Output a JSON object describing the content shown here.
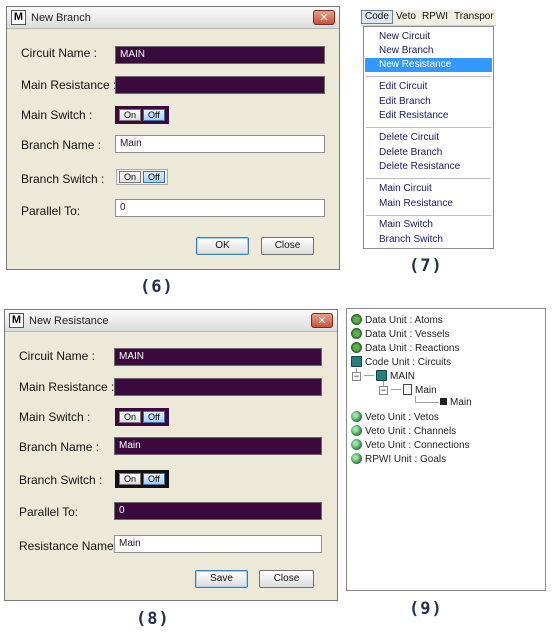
{
  "panel6": {
    "title": "New Branch",
    "app_icon": "M",
    "labels": {
      "circuit_name": "Circuit Name :",
      "main_resistance": "Main Resistance :",
      "main_switch": "Main Switch :",
      "branch_name": "Branch Name :",
      "branch_switch": "Branch Switch :",
      "parallel_to": "Parallel To:"
    },
    "values": {
      "circuit_name": "MAIN",
      "main_resistance": "",
      "branch_name": "Main",
      "parallel_to": "0"
    },
    "switch_on": "On",
    "switch_off": "Off",
    "ok_button": "OK",
    "close_button": "Close",
    "caption": "(6)"
  },
  "panel7": {
    "menubar": [
      "Code",
      "Veto",
      "RPWI",
      "Transpor"
    ],
    "items": [
      "New Circuit",
      "New Branch",
      "New Resistance",
      "Edit Circuit",
      "Edit Branch",
      "Edit Resistance",
      "Delete Circuit",
      "Delete Branch",
      "Delete Resistance",
      "Main Circuit",
      "Main Resistance",
      "Main Switch",
      "Branch Switch"
    ],
    "highlighted": "New Resistance",
    "caption": "(7)"
  },
  "panel8": {
    "title": "New Resistance",
    "app_icon": "M",
    "labels": {
      "circuit_name": "Circuit Name :",
      "main_resistance": "Main Resistance :",
      "main_switch": "Main Switch :",
      "branch_name": "Branch Name :",
      "branch_switch": "Branch Switch :",
      "parallel_to": "Parallel To:",
      "resistance_name": "Resistance Name"
    },
    "values": {
      "circuit_name": "MAIN",
      "main_resistance": "",
      "branch_name": "Main",
      "parallel_to": "0",
      "resistance_name": "Main"
    },
    "switch_on": "On",
    "switch_off": "Off",
    "save_button": "Save",
    "close_button": "Close",
    "caption": "(8)"
  },
  "panel9": {
    "nodes": [
      "Data Unit : Atoms",
      "Data Unit : Vessels",
      "Data Unit : Reactions",
      "Code Unit : Circuits",
      "MAIN",
      "Main",
      "Main",
      "Veto Unit : Vetos",
      "Veto Unit : Channels",
      "Veto Unit : Connections",
      "RPWI Unit : Goals"
    ],
    "expander": "−",
    "caption": "(9)"
  }
}
